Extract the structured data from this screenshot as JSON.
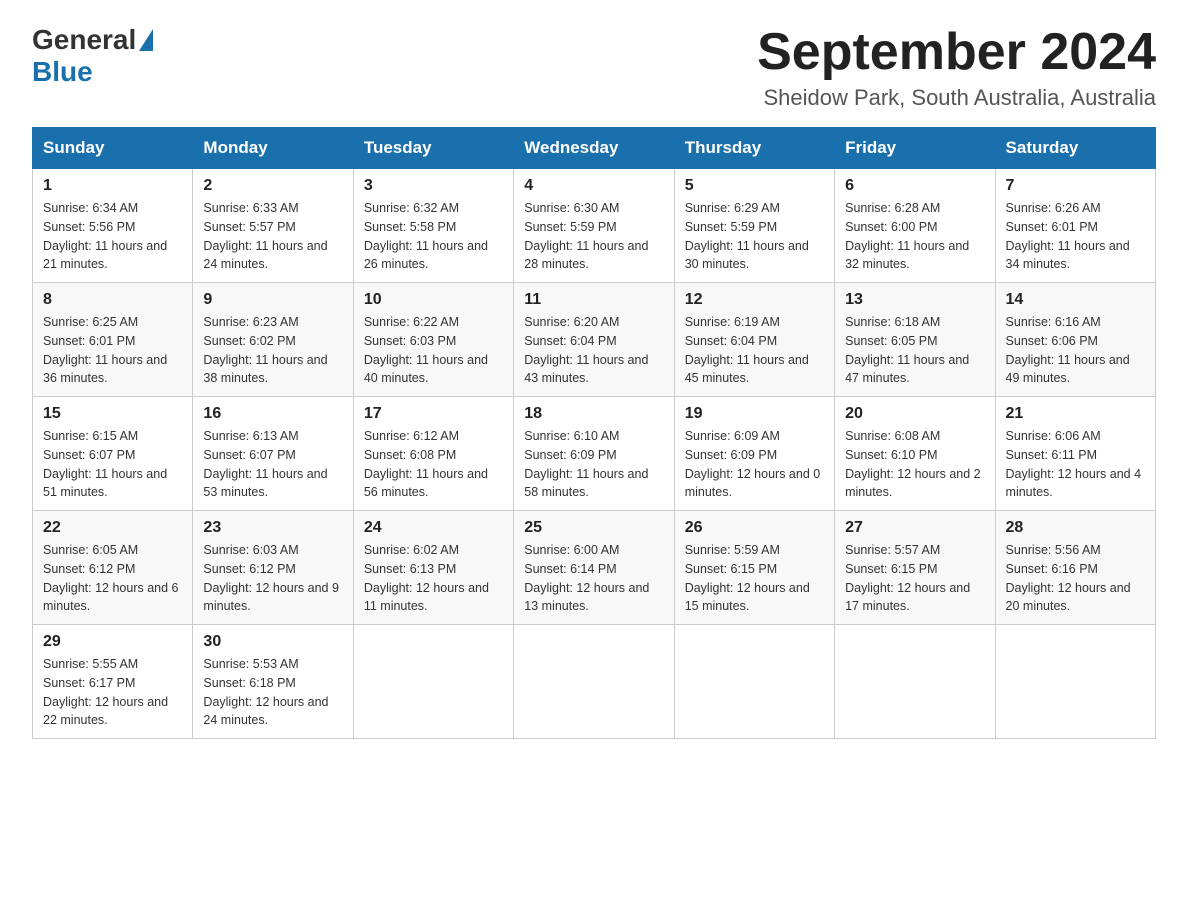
{
  "header": {
    "logo_general": "General",
    "logo_blue": "Blue",
    "month_title": "September 2024",
    "location": "Sheidow Park, South Australia, Australia"
  },
  "weekdays": [
    "Sunday",
    "Monday",
    "Tuesday",
    "Wednesday",
    "Thursday",
    "Friday",
    "Saturday"
  ],
  "weeks": [
    [
      {
        "day": "1",
        "sunrise": "6:34 AM",
        "sunset": "5:56 PM",
        "daylight": "11 hours and 21 minutes."
      },
      {
        "day": "2",
        "sunrise": "6:33 AM",
        "sunset": "5:57 PM",
        "daylight": "11 hours and 24 minutes."
      },
      {
        "day": "3",
        "sunrise": "6:32 AM",
        "sunset": "5:58 PM",
        "daylight": "11 hours and 26 minutes."
      },
      {
        "day": "4",
        "sunrise": "6:30 AM",
        "sunset": "5:59 PM",
        "daylight": "11 hours and 28 minutes."
      },
      {
        "day": "5",
        "sunrise": "6:29 AM",
        "sunset": "5:59 PM",
        "daylight": "11 hours and 30 minutes."
      },
      {
        "day": "6",
        "sunrise": "6:28 AM",
        "sunset": "6:00 PM",
        "daylight": "11 hours and 32 minutes."
      },
      {
        "day": "7",
        "sunrise": "6:26 AM",
        "sunset": "6:01 PM",
        "daylight": "11 hours and 34 minutes."
      }
    ],
    [
      {
        "day": "8",
        "sunrise": "6:25 AM",
        "sunset": "6:01 PM",
        "daylight": "11 hours and 36 minutes."
      },
      {
        "day": "9",
        "sunrise": "6:23 AM",
        "sunset": "6:02 PM",
        "daylight": "11 hours and 38 minutes."
      },
      {
        "day": "10",
        "sunrise": "6:22 AM",
        "sunset": "6:03 PM",
        "daylight": "11 hours and 40 minutes."
      },
      {
        "day": "11",
        "sunrise": "6:20 AM",
        "sunset": "6:04 PM",
        "daylight": "11 hours and 43 minutes."
      },
      {
        "day": "12",
        "sunrise": "6:19 AM",
        "sunset": "6:04 PM",
        "daylight": "11 hours and 45 minutes."
      },
      {
        "day": "13",
        "sunrise": "6:18 AM",
        "sunset": "6:05 PM",
        "daylight": "11 hours and 47 minutes."
      },
      {
        "day": "14",
        "sunrise": "6:16 AM",
        "sunset": "6:06 PM",
        "daylight": "11 hours and 49 minutes."
      }
    ],
    [
      {
        "day": "15",
        "sunrise": "6:15 AM",
        "sunset": "6:07 PM",
        "daylight": "11 hours and 51 minutes."
      },
      {
        "day": "16",
        "sunrise": "6:13 AM",
        "sunset": "6:07 PM",
        "daylight": "11 hours and 53 minutes."
      },
      {
        "day": "17",
        "sunrise": "6:12 AM",
        "sunset": "6:08 PM",
        "daylight": "11 hours and 56 minutes."
      },
      {
        "day": "18",
        "sunrise": "6:10 AM",
        "sunset": "6:09 PM",
        "daylight": "11 hours and 58 minutes."
      },
      {
        "day": "19",
        "sunrise": "6:09 AM",
        "sunset": "6:09 PM",
        "daylight": "12 hours and 0 minutes."
      },
      {
        "day": "20",
        "sunrise": "6:08 AM",
        "sunset": "6:10 PM",
        "daylight": "12 hours and 2 minutes."
      },
      {
        "day": "21",
        "sunrise": "6:06 AM",
        "sunset": "6:11 PM",
        "daylight": "12 hours and 4 minutes."
      }
    ],
    [
      {
        "day": "22",
        "sunrise": "6:05 AM",
        "sunset": "6:12 PM",
        "daylight": "12 hours and 6 minutes."
      },
      {
        "day": "23",
        "sunrise": "6:03 AM",
        "sunset": "6:12 PM",
        "daylight": "12 hours and 9 minutes."
      },
      {
        "day": "24",
        "sunrise": "6:02 AM",
        "sunset": "6:13 PM",
        "daylight": "12 hours and 11 minutes."
      },
      {
        "day": "25",
        "sunrise": "6:00 AM",
        "sunset": "6:14 PM",
        "daylight": "12 hours and 13 minutes."
      },
      {
        "day": "26",
        "sunrise": "5:59 AM",
        "sunset": "6:15 PM",
        "daylight": "12 hours and 15 minutes."
      },
      {
        "day": "27",
        "sunrise": "5:57 AM",
        "sunset": "6:15 PM",
        "daylight": "12 hours and 17 minutes."
      },
      {
        "day": "28",
        "sunrise": "5:56 AM",
        "sunset": "6:16 PM",
        "daylight": "12 hours and 20 minutes."
      }
    ],
    [
      {
        "day": "29",
        "sunrise": "5:55 AM",
        "sunset": "6:17 PM",
        "daylight": "12 hours and 22 minutes."
      },
      {
        "day": "30",
        "sunrise": "5:53 AM",
        "sunset": "6:18 PM",
        "daylight": "12 hours and 24 minutes."
      },
      null,
      null,
      null,
      null,
      null
    ]
  ]
}
